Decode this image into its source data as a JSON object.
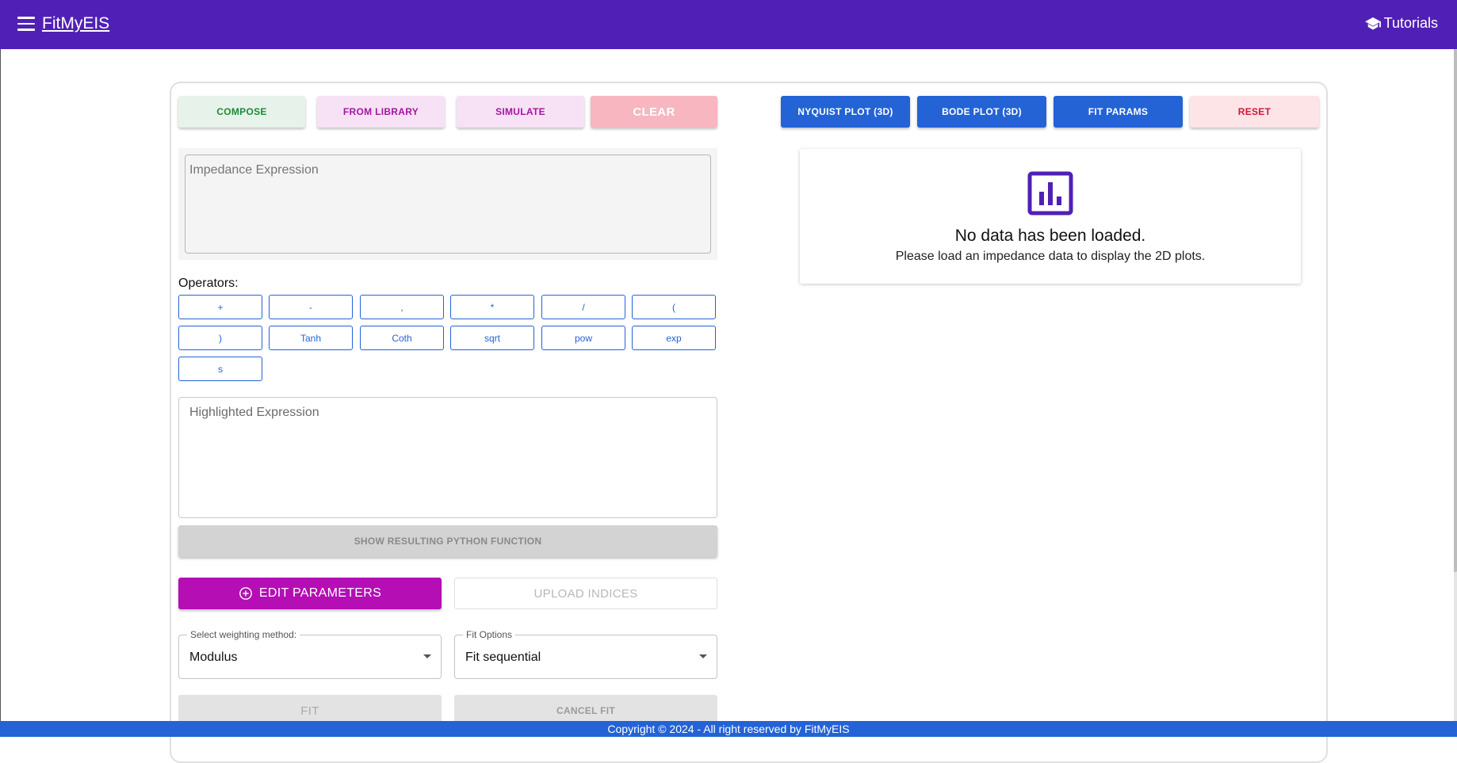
{
  "app": {
    "title": "FitMyEIS",
    "tutorials_label": "Tutorials"
  },
  "toolbar_left": {
    "compose": "COMPOSE",
    "from_library": "FROM LIBRARY",
    "simulate": "SIMULATE",
    "clear": "CLEAR"
  },
  "toolbar_right": {
    "nyquist": "NYQUIST PLOT (3D)",
    "bode": "BODE PLOT (3D)",
    "fit_params": "FIT PARAMS",
    "reset": "RESET"
  },
  "impedance": {
    "placeholder": "Impedance Expression",
    "value": ""
  },
  "operators": {
    "label": "Operators:",
    "items": [
      "+",
      "-",
      ",",
      "*",
      "/",
      "(",
      ")",
      "Tanh",
      "Coth",
      "sqrt",
      "pow",
      "exp",
      "s"
    ]
  },
  "highlighted": {
    "placeholder": "Highlighted Expression"
  },
  "actions": {
    "show_python": "SHOW RESULTING PYTHON FUNCTION",
    "edit_parameters": "EDIT PARAMETERS",
    "upload_indices": "UPLOAD INDICES",
    "fit": "FIT",
    "cancel_fit": "CANCEL FIT"
  },
  "weighting": {
    "label": "Select weighting method:",
    "value": "Modulus"
  },
  "fit_options": {
    "label": "Fit Options",
    "value": "Fit sequential"
  },
  "no_data": {
    "title": "No data has been loaded.",
    "message": "Please load an impedance data to display the 2D plots."
  },
  "footer": {
    "text": "Copyright © 2024 - All right reserved by FitMyEIS"
  },
  "colors": {
    "appbar": "#5020b6",
    "primary_blue": "#2363d6",
    "magenta": "#b40eb4",
    "reset_red": "#d21436"
  }
}
